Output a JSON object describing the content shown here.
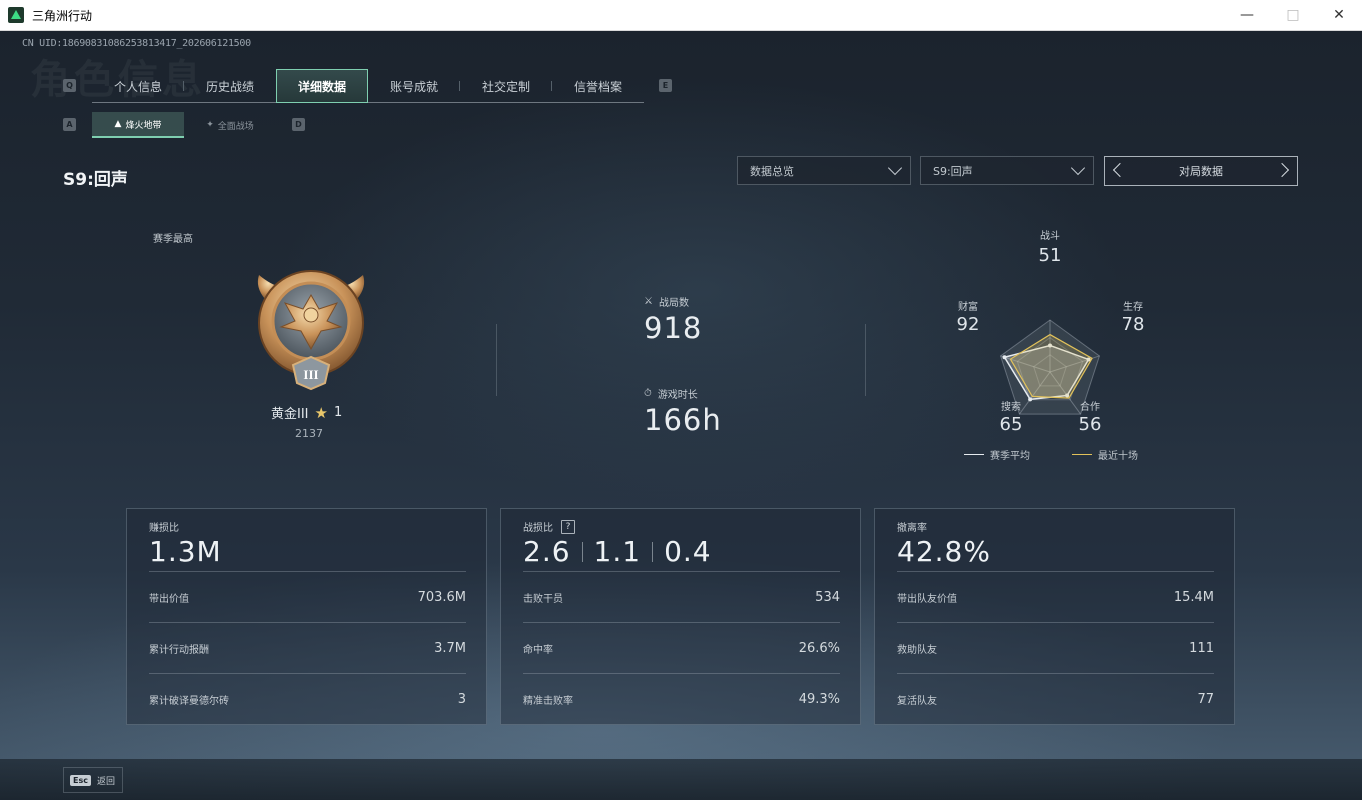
{
  "window": {
    "title": "三角洲行动"
  },
  "uid": "CN UID:18690831086253813417_202606121500",
  "bg_title": "角色信息",
  "key_hints": {
    "tab_prev": "Q",
    "tab_next": "E",
    "sub_prev": "A",
    "sub_next": "D"
  },
  "tabs": [
    {
      "label": "个人信息"
    },
    {
      "label": "历史战绩"
    },
    {
      "label": "详细数据",
      "active": true
    },
    {
      "label": "账号成就"
    },
    {
      "label": "社交定制"
    },
    {
      "label": "信誉档案"
    }
  ],
  "subtabs": [
    {
      "label": "烽火地带",
      "active": true
    },
    {
      "label": "全面战场"
    }
  ],
  "season_title": "S9:回声",
  "filters": {
    "view": "数据总览",
    "season": "S9:回声",
    "mode": "对局数据"
  },
  "peak": {
    "label": "赛季最高",
    "rank": "黄金III",
    "stars": "1",
    "score": "2137",
    "medal_numeral": "III"
  },
  "summary": {
    "matches_label": "战局数",
    "matches": "918",
    "playtime_label": "游戏时长",
    "playtime": "166h"
  },
  "radar": {
    "axes": [
      {
        "label": "战斗",
        "value": 51
      },
      {
        "label": "生存",
        "value": 78
      },
      {
        "label": "合作",
        "value": 56
      },
      {
        "label": "搜索",
        "value": 65
      },
      {
        "label": "财富",
        "value": 92
      }
    ],
    "recent": [
      72,
      85,
      62,
      58,
      80
    ],
    "legend_season": "赛季平均",
    "legend_recent": "最近十场",
    "color_season": "#e6ebef",
    "color_recent": "#e2c25a"
  },
  "cards": [
    {
      "label": "赚损比",
      "big": "1.3M",
      "rows": [
        {
          "label": "带出价值",
          "value": "703.6M"
        },
        {
          "label": "累计行动报酬",
          "value": "3.7M"
        },
        {
          "label": "累计破译曼德尔砖",
          "value": "3"
        }
      ]
    },
    {
      "label": "战损比",
      "help": "?",
      "big_parts": [
        "2.6",
        "1.1",
        "0.4"
      ],
      "rows": [
        {
          "label": "击败干员",
          "value": "534"
        },
        {
          "label": "命中率",
          "value": "26.6%"
        },
        {
          "label": "精准击败率",
          "value": "49.3%"
        }
      ]
    },
    {
      "label": "撤离率",
      "big": "42.8%",
      "rows": [
        {
          "label": "带出队友价值",
          "value": "15.4M"
        },
        {
          "label": "救助队友",
          "value": "111"
        },
        {
          "label": "复活队友",
          "value": "77"
        }
      ]
    }
  ],
  "footer": {
    "key": "Esc",
    "label": "返回"
  }
}
